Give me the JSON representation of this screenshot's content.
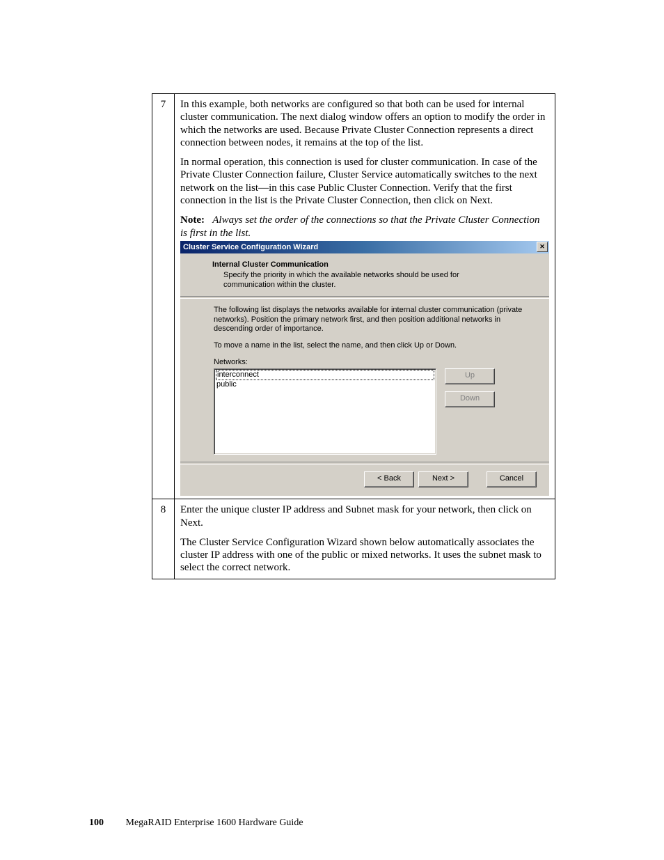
{
  "footer": {
    "page_number": "100",
    "guide_title": "MegaRAID Enterprise 1600 Hardware Guide"
  },
  "steps": {
    "s7": {
      "num": "7",
      "para1": "In this example, both networks are configured so that both can be used for internal cluster communication. The next dialog window offers an option to modify the order in which the networks are used. Because Private Cluster Connection represents a direct connection between nodes, it remains at the top of the list.",
      "para2": "In normal operation, this connection is used for cluster communication. In case of the Private Cluster Connection failure, Cluster Service automatically switches to the next network on the list—in this case Public Cluster Connection. Verify that the first connection in the list is the Private Cluster Connection, then click on Next.",
      "note_label": "Note:",
      "note_text": "Always set the order of the connections so that the Private Cluster Connection is first in the list."
    },
    "s8": {
      "num": "8",
      "para1": "Enter the unique cluster IP address and Subnet mask for your network, then click on Next.",
      "para2": "The Cluster Service Configuration Wizard shown below automatically associates the cluster IP address with one of the public or mixed networks. It uses the subnet mask to select the correct network."
    }
  },
  "dialog": {
    "title": "Cluster Service Configuration Wizard",
    "close_glyph": "✕",
    "header_title": "Internal Cluster Communication",
    "header_sub": "Specify the priority in which the available networks should be used for communication within the cluster.",
    "body_para1": "The following list displays the networks available for internal cluster communication (private networks). Position the primary network first, and then position additional networks in descending order of importance.",
    "body_para2": "To move a name in the list, select the name, and then click Up or Down.",
    "list_label": "Networks:",
    "items": {
      "i0": "interconnect",
      "i1": "public"
    },
    "buttons": {
      "up": "Up",
      "down": "Down",
      "back": "< Back",
      "next": "Next >",
      "cancel": "Cancel"
    }
  }
}
